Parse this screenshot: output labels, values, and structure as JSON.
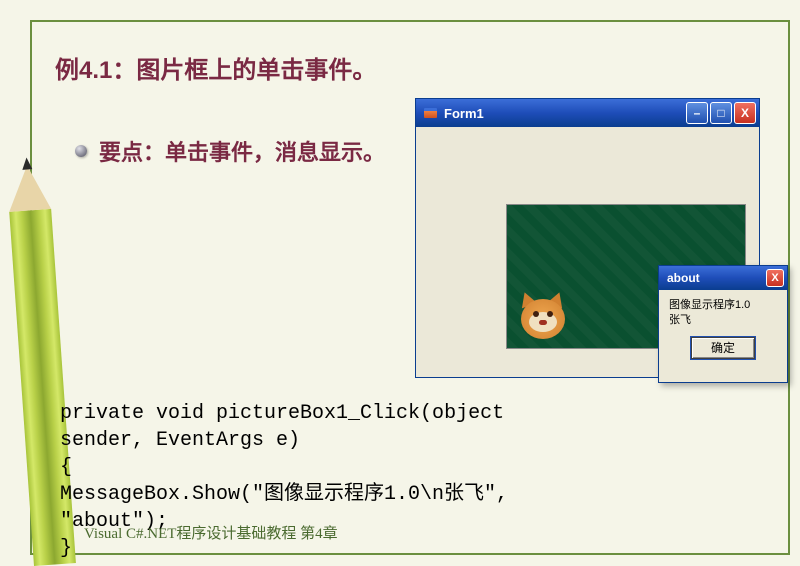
{
  "slide": {
    "title": "例4.1：图片框上的单击事件。",
    "bullet": "要点：单击事件，消息显示。",
    "footer": "Visual C#.NET程序设计基础教程 第4章"
  },
  "form1": {
    "title": "Form1",
    "minimize": "–",
    "maximize": "□",
    "close": "X"
  },
  "aboutbox": {
    "title": "about",
    "message_line1": "图像显示程序1.0",
    "message_line2": "张飞",
    "ok": "确定",
    "close": "X"
  },
  "code": {
    "line1": "private void pictureBox1_Click(object",
    "line2": "sender, EventArgs e)",
    "line3": "{",
    "line4": "MessageBox.Show(\"图像显示程序1.0\\n张飞\",",
    "line5": "\"about\");",
    "line6": "}"
  }
}
